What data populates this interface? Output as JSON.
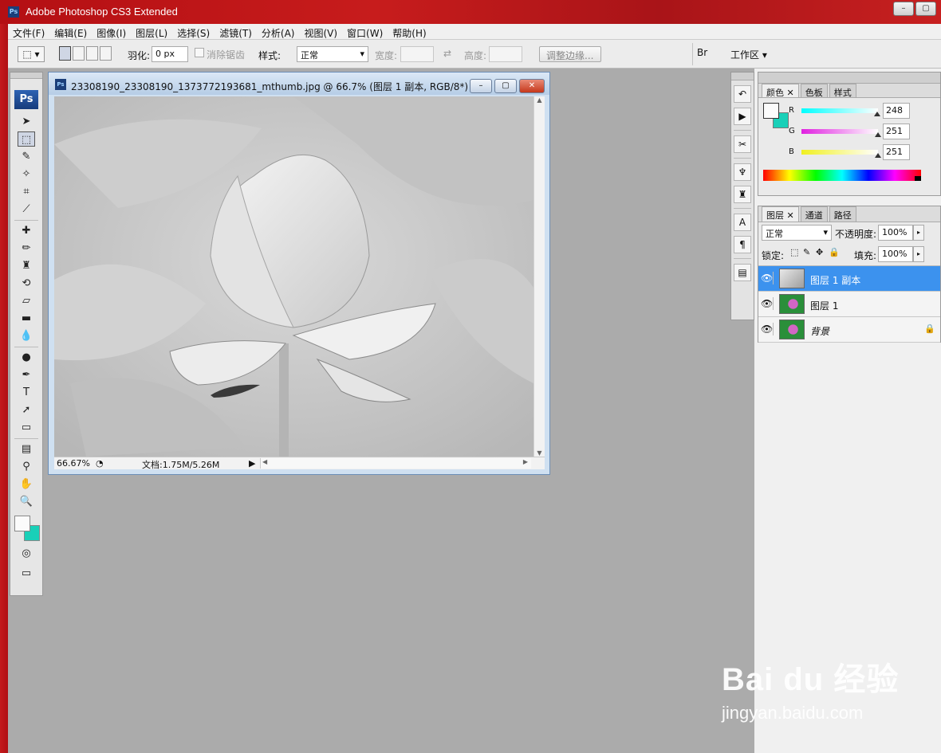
{
  "app": {
    "title": "Adobe Photoshop CS3 Extended",
    "badge": "Ps"
  },
  "window_controls": [
    "–",
    "▢",
    "✕"
  ],
  "menu": [
    "文件(F)",
    "编辑(E)",
    "图像(I)",
    "图层(L)",
    "选择(S)",
    "滤镜(T)",
    "分析(A)",
    "视图(V)",
    "窗口(W)",
    "帮助(H)"
  ],
  "options": {
    "feather_label": "羽化:",
    "feather_value": "0 px",
    "antialias_label": "消除锯齿",
    "style_label": "样式:",
    "style_value": "正常",
    "width_label": "宽度:",
    "height_label": "高度:",
    "refine_edge": "调整边缘...",
    "workspace": "工作区"
  },
  "toolbox": {
    "logo": "Ps",
    "tools": [
      {
        "name": "move-tool",
        "glyph": "➤"
      },
      {
        "name": "marquee-tool",
        "glyph": "⬚"
      },
      {
        "name": "lasso-tool",
        "glyph": "✎"
      },
      {
        "name": "magic-wand-tool",
        "glyph": "✧"
      },
      {
        "name": "crop-tool",
        "glyph": "⌗"
      },
      {
        "name": "slice-tool",
        "glyph": "⟋"
      },
      {
        "name": "healing-brush-tool",
        "glyph": "✚"
      },
      {
        "name": "brush-tool",
        "glyph": "✏"
      },
      {
        "name": "clone-stamp-tool",
        "glyph": "♜"
      },
      {
        "name": "history-brush-tool",
        "glyph": "⟲"
      },
      {
        "name": "eraser-tool",
        "glyph": "▱"
      },
      {
        "name": "gradient-tool",
        "glyph": "▬"
      },
      {
        "name": "blur-tool",
        "glyph": "💧"
      },
      {
        "name": "dodge-tool",
        "glyph": "●"
      },
      {
        "name": "pen-tool",
        "glyph": "✒"
      },
      {
        "name": "type-tool",
        "glyph": "T"
      },
      {
        "name": "path-selection-tool",
        "glyph": "➚"
      },
      {
        "name": "shape-tool",
        "glyph": "▭"
      },
      {
        "name": "notes-tool",
        "glyph": "▤"
      },
      {
        "name": "eyedropper-tool",
        "glyph": "⚲"
      },
      {
        "name": "hand-tool",
        "glyph": "✋"
      },
      {
        "name": "zoom-tool",
        "glyph": "🔍"
      }
    ]
  },
  "document": {
    "title": "23308190_23308190_1373772193681_mthumb.jpg @ 66.7% (图层 1 副本, RGB/8*)",
    "zoom": "66.67%",
    "doc_size": "文档:1.75M/5.26M"
  },
  "color_panel": {
    "tabs": [
      "颜色",
      "色板",
      "样式"
    ],
    "r_label": "R",
    "g_label": "G",
    "b_label": "B",
    "r": "248",
    "g": "251",
    "b": "251",
    "fg_color": "#fbfbfb",
    "bg_color": "#19d0b8"
  },
  "layers_panel": {
    "tabs": [
      "图层",
      "通道",
      "路径"
    ],
    "blend_mode": "正常",
    "opacity_label": "不透明度:",
    "opacity": "100%",
    "lock_label": "锁定:",
    "fill_label": "填充:",
    "fill": "100%",
    "layers": [
      {
        "name": "图层 1 副本",
        "selected": true
      },
      {
        "name": "图层 1",
        "selected": false
      },
      {
        "name": "背景",
        "selected": false,
        "locked": true
      }
    ]
  },
  "watermark": {
    "brand": "Bai du 经验",
    "url": "jingyan.baidu.com"
  }
}
